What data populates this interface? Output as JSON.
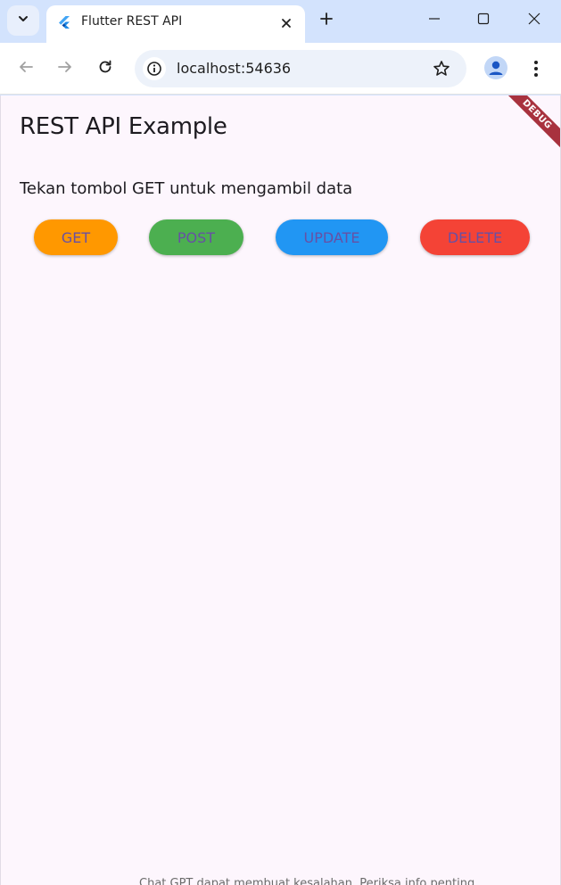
{
  "browser": {
    "tab_title": "Flutter REST API",
    "url": "localhost:54636"
  },
  "app": {
    "title": "REST API Example",
    "message": "Tekan tombol GET untuk mengambil data",
    "debug_label": "DEBUG",
    "buttons": [
      {
        "label": "GET",
        "color": "#ff9800"
      },
      {
        "label": "POST",
        "color": "#4caf50"
      },
      {
        "label": "UPDATE",
        "color": "#2196f3"
      },
      {
        "label": "DELETE",
        "color": "#f44336"
      }
    ],
    "footer_clipped_text": "Chat GPT dapat membuat kesalahan. Periksa info penting."
  },
  "icons": {
    "tab_search": "chevron-down-icon",
    "favicon": "flutter-logo-icon",
    "tab_close": "close-icon",
    "new_tab": "plus-icon",
    "minimize": "minimize-icon",
    "maximize": "maximize-icon",
    "close_window": "close-icon",
    "back": "arrow-left-icon",
    "forward": "arrow-right-icon",
    "reload": "reload-icon",
    "site_info": "info-icon",
    "bookmark": "star-icon",
    "profile": "avatar-icon",
    "menu": "kebab-menu-icon"
  }
}
